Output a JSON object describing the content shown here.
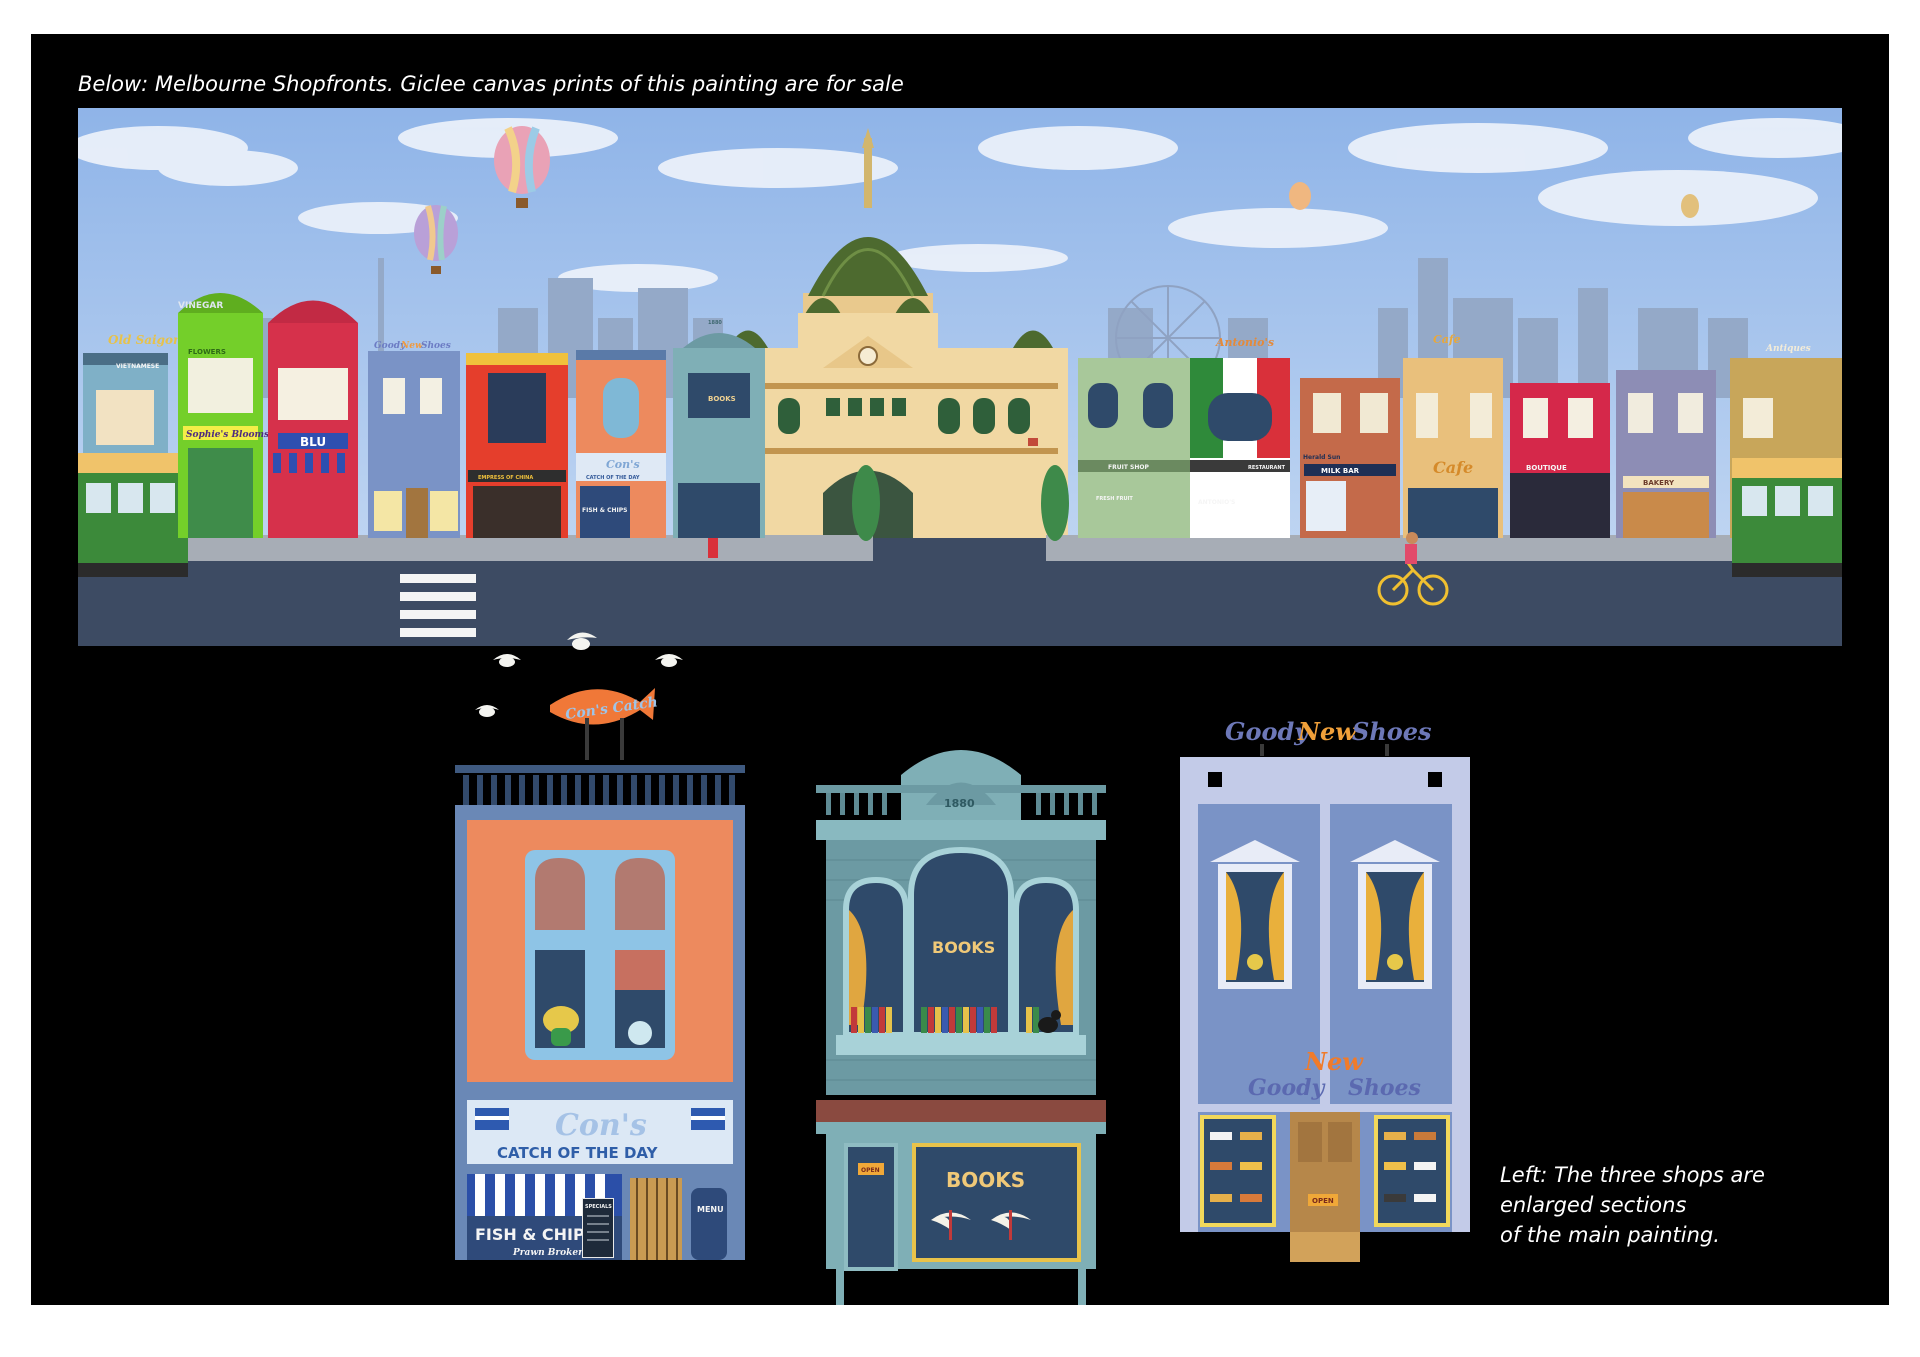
{
  "captions": {
    "top": "Below: Melbourne Shopfronts. Giclee canvas prints of this painting are for sale",
    "side_lines": [
      "Left: The three shops are",
      "enlarged sections",
      "of the main painting."
    ]
  },
  "panorama_signs": {
    "old_saigon": "Old Saigon",
    "vietnamese": "VIETNAMESE",
    "vinegar": "VINEGAR",
    "flowers": "FLOWERS",
    "sophies": "Sophie's Blooms",
    "blu": "BLU",
    "goody": "Goody",
    "new": "New",
    "shoes": "Shoes",
    "empress": "EMPRESS OF CHINA",
    "cons": "Con's",
    "catch": "CATCH OF THE DAY",
    "fish_chips": "FISH & CHIPS",
    "books": "BOOKS",
    "fruit_shop": "FRUIT SHOP",
    "fresh_fruit": "FRESH FRUIT",
    "antonios": "Antonio's",
    "antonios_caps": "ANTONIO'S",
    "restaurant": "RESTAURANT",
    "herald_sun": "Herald Sun",
    "milk_bar": "MILK BAR",
    "cafe": "Cafe",
    "boutique": "BOUTIQUE",
    "bakery": "BAKERY",
    "antiques": "Antiques",
    "year_1880": "1880"
  },
  "shop1": {
    "sign_script": "Con's Catch",
    "name_script": "Con's",
    "banner": "CATCH OF THE DAY",
    "fish_chips": "FISH & CHIPS",
    "prawn": "Prawn Broker",
    "menu": "MENU",
    "specials": "SPECIALS"
  },
  "shop2": {
    "year": "1880",
    "books_upper": "BOOKS",
    "books_lower": "BOOKS",
    "open": "OPEN"
  },
  "shop3": {
    "top_goody": "Goody",
    "top_new": "New",
    "top_shoes": "Shoes",
    "goody": "Goody",
    "new": "New",
    "shoes": "Shoes",
    "open": "OPEN"
  },
  "colors": {
    "sky": "#a9c8ee",
    "road": "#3d4b63",
    "footpath": "#a7adb6",
    "tram": "#3c8a3a",
    "dome": "#4f6d2e",
    "station": "#f1d8a3",
    "cons_orange": "#ed8a5e",
    "books_teal": "#7fafb6",
    "goody_blue": "#7a93c6"
  }
}
